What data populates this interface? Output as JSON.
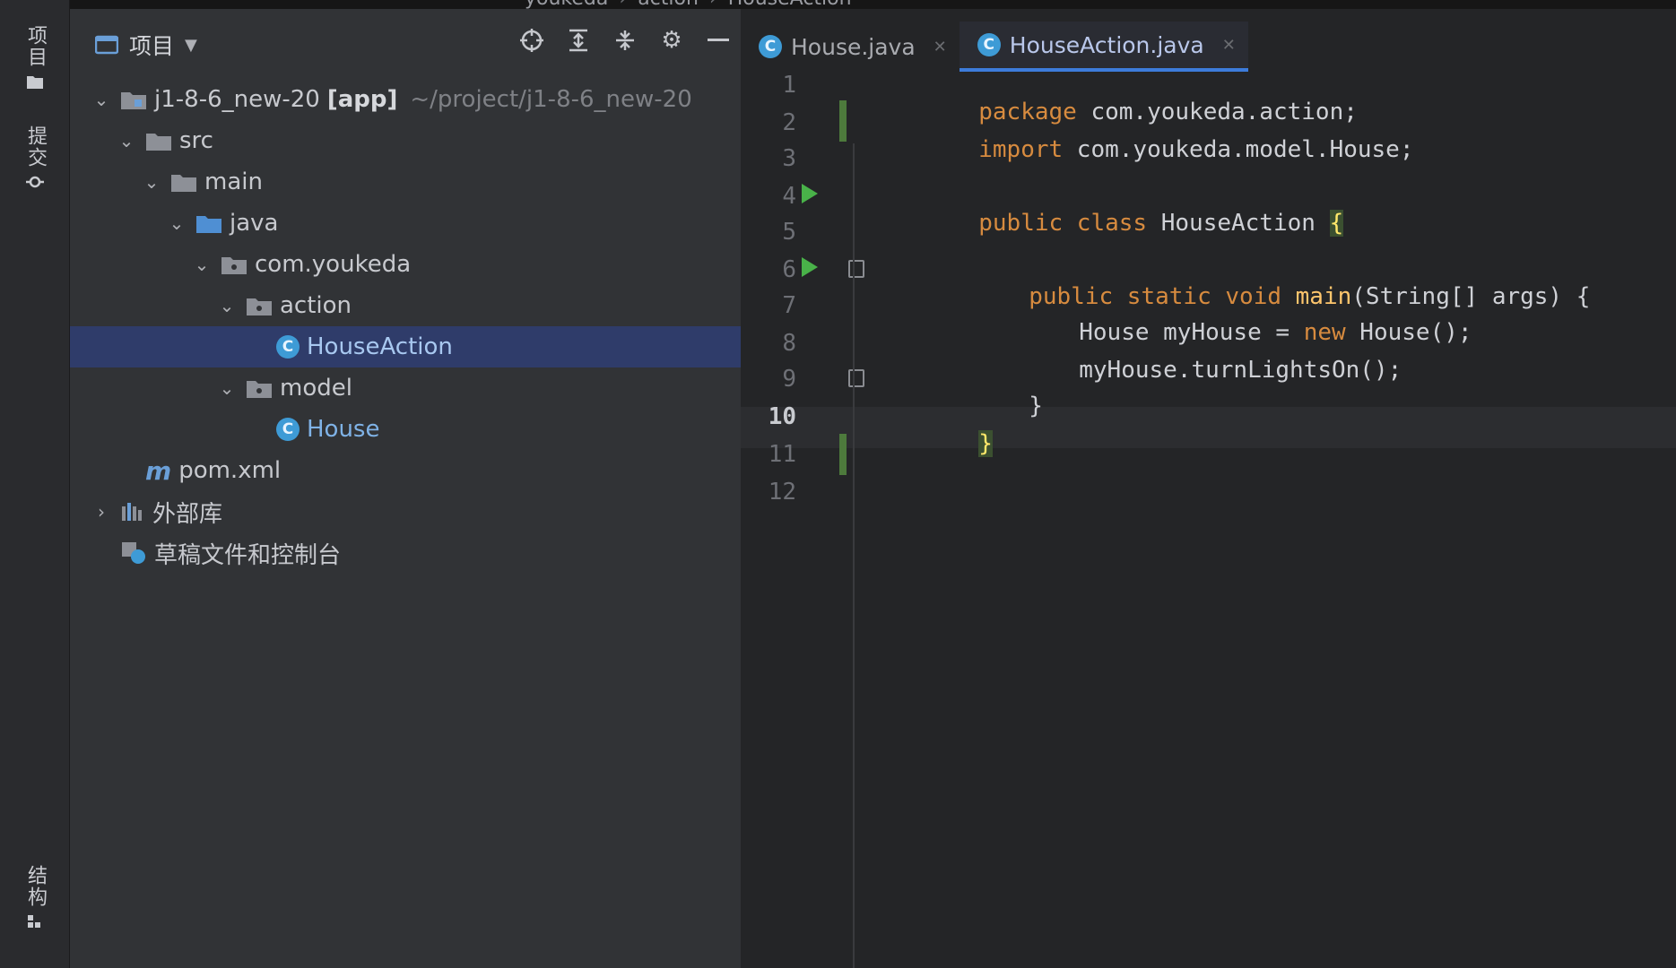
{
  "breadcrumb": [
    "youkeda",
    "action",
    "HouseAction"
  ],
  "left_strip": {
    "project_label": "项目",
    "commit_label": "提交",
    "structure_label": "结构"
  },
  "project_panel": {
    "title": "项目",
    "tools": [
      "locate-icon",
      "expand-all-icon",
      "collapse-all-icon",
      "gear-icon",
      "minimize-icon"
    ],
    "tree": [
      {
        "label": "j1-8-6_new-20",
        "bold_suffix": "[app]",
        "hint": "~/project/j1-8-6_new-20",
        "depth": 0,
        "expanded": true,
        "icon": "module-folder-icon"
      },
      {
        "label": "src",
        "depth": 1,
        "expanded": true,
        "icon": "folder-icon"
      },
      {
        "label": "main",
        "depth": 2,
        "expanded": true,
        "icon": "folder-icon"
      },
      {
        "label": "java",
        "depth": 3,
        "expanded": true,
        "icon": "source-folder-icon"
      },
      {
        "label": "com.youkeda",
        "depth": 4,
        "expanded": true,
        "icon": "package-icon"
      },
      {
        "label": "action",
        "depth": 5,
        "expanded": true,
        "icon": "package-icon"
      },
      {
        "label": "HouseAction",
        "depth": 6,
        "icon": "java-class-icon",
        "selected": true
      },
      {
        "label": "model",
        "depth": 5,
        "expanded": true,
        "icon": "package-icon"
      },
      {
        "label": "House",
        "depth": 6,
        "icon": "java-class-icon"
      },
      {
        "label": "pom.xml",
        "depth": 1,
        "icon": "maven-icon"
      },
      {
        "label": "外部库",
        "depth": 0,
        "expanded": false,
        "icon": "library-icon"
      },
      {
        "label": "草稿文件和控制台",
        "depth": 0,
        "icon": "scratch-icon"
      }
    ]
  },
  "editor": {
    "tabs": [
      {
        "label": "House.java",
        "active": false
      },
      {
        "label": "HouseAction.java",
        "active": true
      }
    ],
    "line_numbers": [
      "1",
      "2",
      "3",
      "4",
      "5",
      "6",
      "7",
      "8",
      "9",
      "10",
      "11",
      "12"
    ],
    "current_line": "10",
    "code": {
      "l1_kw": "package",
      "l1_rest": " com.youkeda.action;",
      "l2_kw": "import",
      "l2_rest": " com.youkeda.model.House;",
      "l4_kw": "public class",
      "l4_name": " HouseAction ",
      "l4_brace": "{",
      "l6_kw": "public static void",
      "l6_fn": "main",
      "l6_rest": "(String[] args) {",
      "l7_a": "House myHouse = ",
      "l7_kw": "new",
      "l7_b": " House();",
      "l8": "myHouse.turnLightsOn();",
      "l9": "}",
      "l10": "}"
    }
  }
}
